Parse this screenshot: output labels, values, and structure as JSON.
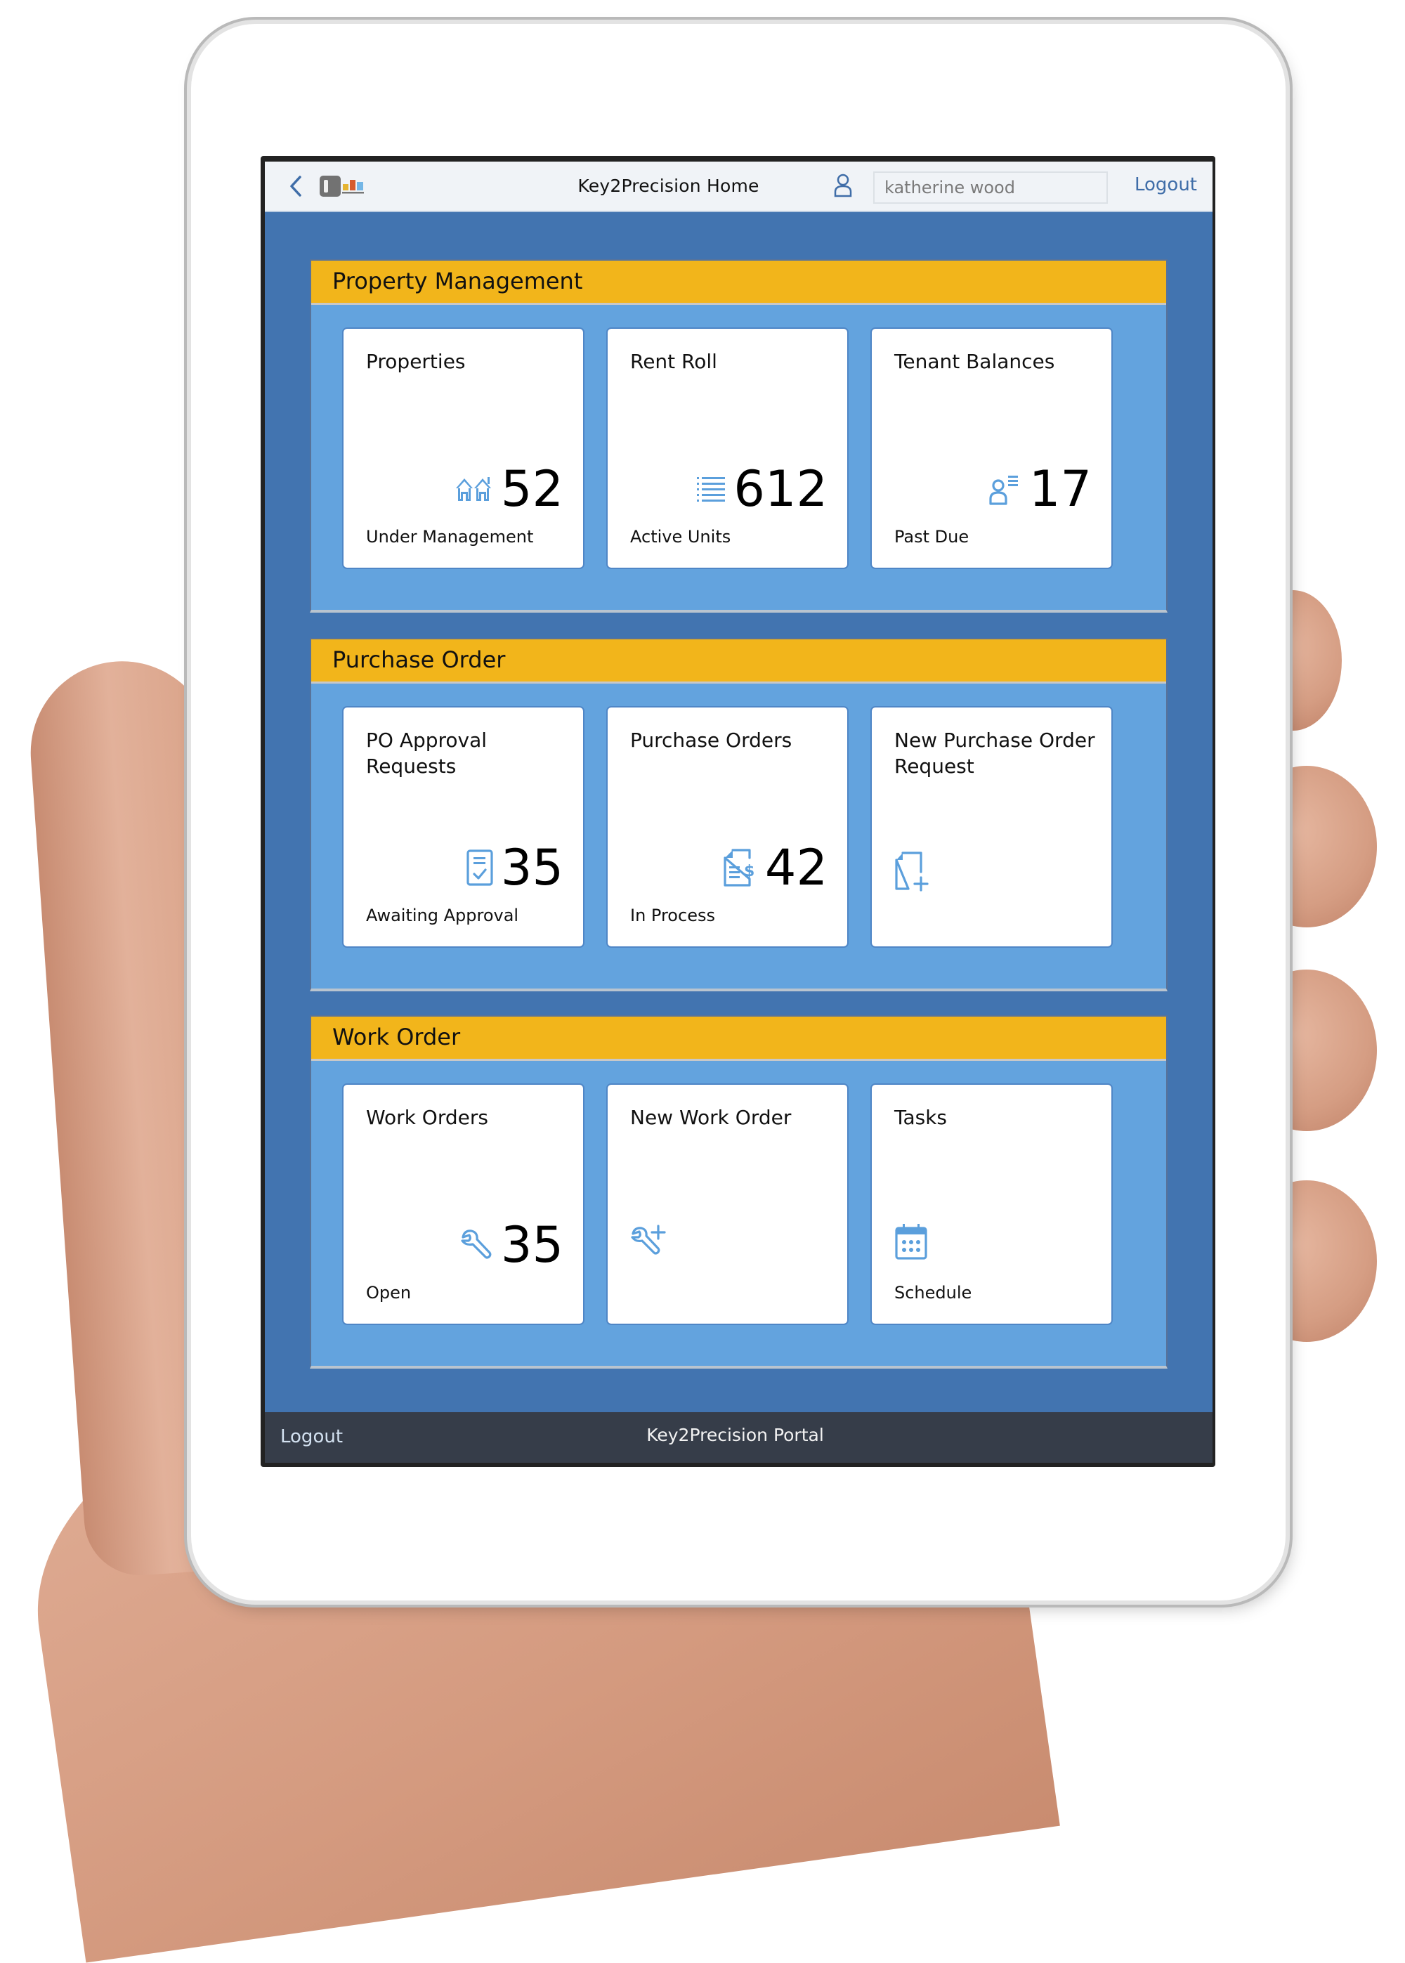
{
  "header": {
    "back_icon": "chevron-left-icon",
    "logo_icon": "app-logo-icon",
    "title": "Key2Precision Home",
    "user_icon": "user-icon",
    "username": "katherine wood",
    "logout_label": "Logout"
  },
  "colors": {
    "section_header": "#f2b51b",
    "section_bg": "#63a3de",
    "page_bg": "#4274b0",
    "footer_bg": "#363d49",
    "icon": "#5b9fdc"
  },
  "sections": [
    {
      "title": "Property Management",
      "tiles": [
        {
          "title": "Properties",
          "value": "52",
          "footer": "Under Management",
          "icon": "houses-icon"
        },
        {
          "title": "Rent Roll",
          "value": "612",
          "footer": "Active Units",
          "icon": "list-icon"
        },
        {
          "title": "Tenant Balances",
          "value": "17",
          "footer": "Past Due",
          "icon": "user-list-icon"
        }
      ]
    },
    {
      "title": "Purchase Order",
      "tiles": [
        {
          "title": "PO Approval Requests",
          "value": "35",
          "footer": "Awaiting Approval",
          "icon": "approval-document-icon"
        },
        {
          "title": "Purchase Orders",
          "value": "42",
          "footer": "In Process",
          "icon": "invoice-dollar-icon"
        },
        {
          "title": "New Purchase Order Request",
          "value": "",
          "footer": "",
          "icon": "new-document-icon"
        }
      ]
    },
    {
      "title": "Work Order",
      "tiles": [
        {
          "title": "Work Orders",
          "value": "35",
          "footer": "Open",
          "icon": "wrench-icon"
        },
        {
          "title": "New Work Order",
          "value": "",
          "footer": "",
          "icon": "wrench-add-icon"
        },
        {
          "title": "Tasks",
          "value": "",
          "footer": "Schedule",
          "icon": "calendar-icon"
        }
      ]
    }
  ],
  "footer": {
    "logout_label": "Logout",
    "title": "Key2Precision Portal"
  }
}
